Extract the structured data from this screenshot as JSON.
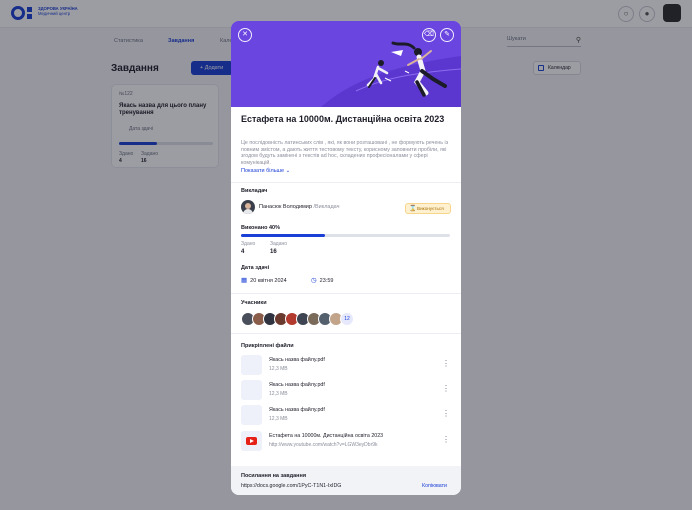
{
  "background": {
    "logo_text": "ЗДОРОВА УКРАЇНА",
    "logo_subtext": "Медичний центр",
    "tabs": [
      "Статистика",
      "Завдання",
      "Календар"
    ],
    "active_tab": "Завдання",
    "search_placeholder": "Шукати",
    "page_title": "Завдання",
    "add_button": "Додати",
    "calendar_button": "Календар",
    "card": {
      "number": "№122",
      "title": "Якась назва для цього плану тренування",
      "date_label": "Дата здачі",
      "done_label": "Здано",
      "total_label": "Задано",
      "done": "4",
      "total": "16",
      "progress": 0.4
    }
  },
  "modal": {
    "title": "Естафета на 10000м. Дистанційна освіта 2023",
    "description": "Це послідовність латинських слів , які, як вони розташовані , не формують речень із повним змістом, а дають життя тестовому тексту, корисному заповнити пробіли, які згодом будуть замінені з текстів ad hoc, складених професіоналами у сфері комунікацій.",
    "show_more": "Показати більше",
    "teacher_label": "Викладач",
    "teacher_name": "Панасюк Володимир",
    "teacher_role": "/Викладач",
    "teacher_badge": "Виконується",
    "progress_label": "Виконано 40%",
    "progress": 0.4,
    "done_label": "Здано",
    "done_value": "4",
    "assigned_label": "Задано",
    "assigned_value": "16",
    "due_label": "Дата здачі",
    "due_date": "20 квітня 2024",
    "due_time": "23:59",
    "participants_label": "Учасники",
    "participants_more": "12",
    "participant_colors": [
      "#4a4f5c",
      "#8a5d4a",
      "#2f3440",
      "#6b3a2e",
      "#b23a2e",
      "#3e4451",
      "#7a6a5a",
      "#55606e",
      "#c2a48a"
    ],
    "files_label": "Прикріплені файли",
    "files": [
      {
        "name": "Якась назва файлу.pdf",
        "size": "12,3 MB"
      },
      {
        "name": "Якась назва файлу.pdf",
        "size": "12,3 MB"
      },
      {
        "name": "Якась назва файлу.pdf",
        "size": "12,3 MB"
      }
    ],
    "video": {
      "name": "Естафета на 10000м. Дистанційна освіта 2023",
      "url": "http://www.youtube.com/watch?v=LGW3eyDbr9k"
    },
    "link_label": "Посилання на завдання",
    "link_url": "https://docs.google.com/1PyC-T1N1-IxIDG",
    "copy_label": "Копіювати",
    "icons": {
      "close": "close-icon",
      "delete": "trash-icon",
      "edit": "edit-icon"
    },
    "accent": "#1a3fd6",
    "hero_color": "#6a45e0"
  }
}
